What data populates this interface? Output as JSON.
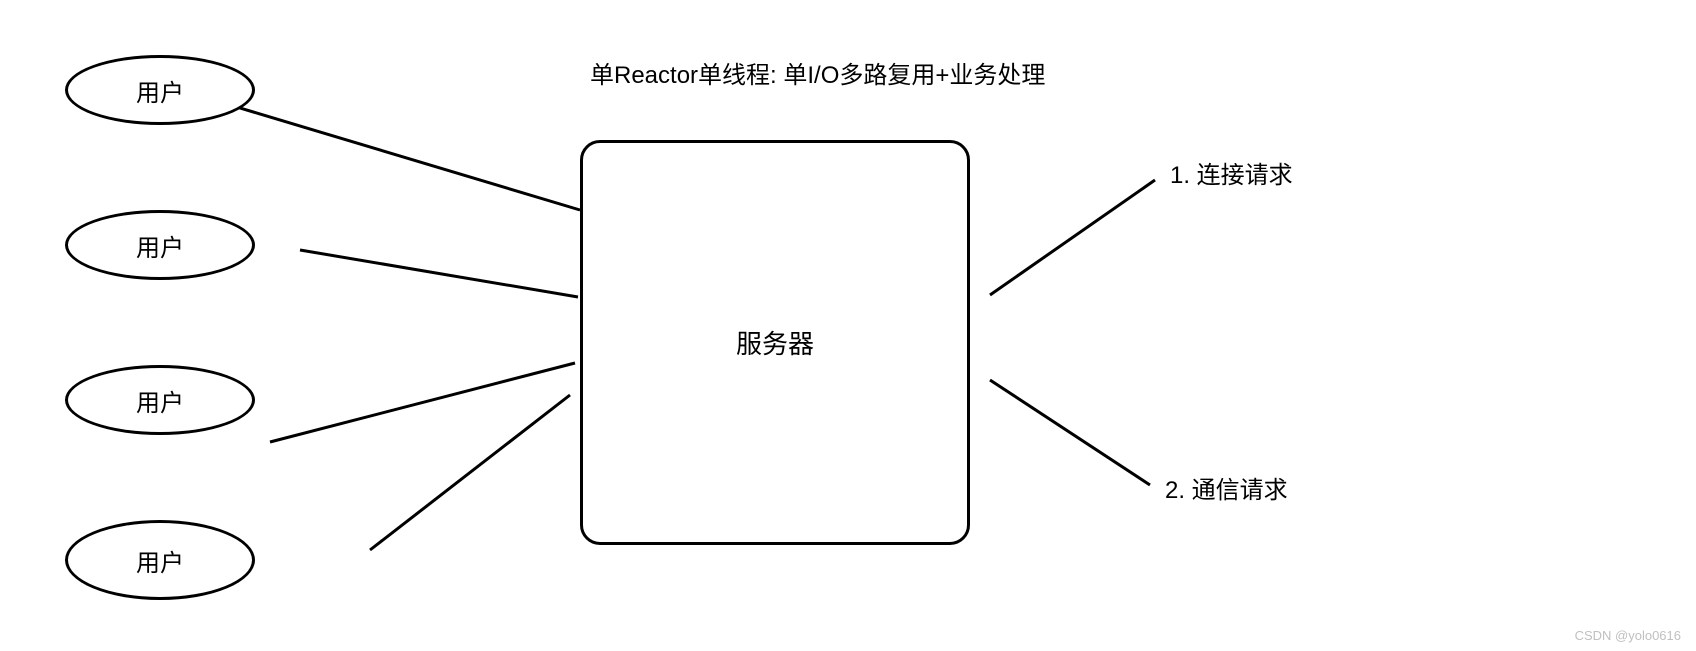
{
  "title": "单Reactor单线程: 单I/O多路复用+业务处理",
  "users": {
    "label": "用户"
  },
  "server": {
    "label": "服务器"
  },
  "annotations": {
    "item1": "1. 连接请求",
    "item2": "2. 通信请求"
  },
  "watermark": "CSDN @yolo0616"
}
